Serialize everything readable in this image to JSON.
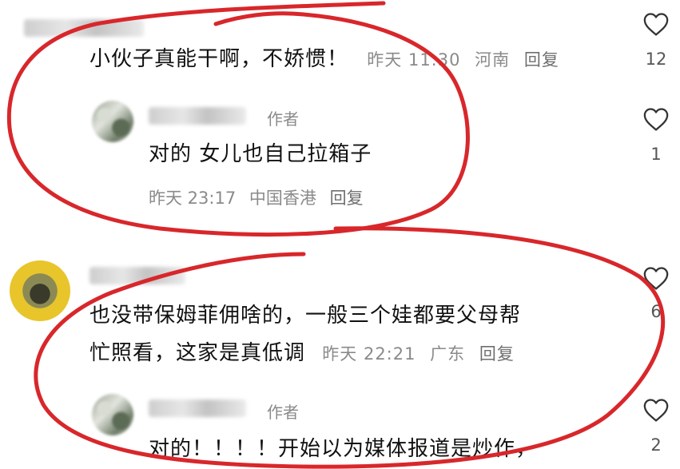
{
  "comments": [
    {
      "text": "小伙子真能干啊，不娇惯！",
      "meta": {
        "time": "昨天 11:30",
        "location": "河南",
        "reply": "回复"
      },
      "likes": "12",
      "reply": {
        "author_tag": "作者",
        "text": "对的 女儿也自己拉箱子",
        "meta": {
          "time": "昨天 23:17",
          "location": "中国香港",
          "reply": "回复"
        },
        "likes": "1"
      }
    },
    {
      "text_lines": [
        "也没带保姆菲佣啥的，一般三个娃都要父母帮",
        "忙照看，这家是真低调"
      ],
      "meta": {
        "time": "昨天 22:21",
        "location": "广东",
        "reply": "回复"
      },
      "likes": "6",
      "reply": {
        "author_tag": "作者",
        "text": "对的！！！！开始以为媒体报道是炒作，",
        "likes": "2"
      }
    }
  ],
  "colors": {
    "annotation_red": "#d8272b",
    "meta_gray": "#8a8a8a",
    "text": "#111111"
  },
  "icons": [
    "heart-outline-icon"
  ]
}
